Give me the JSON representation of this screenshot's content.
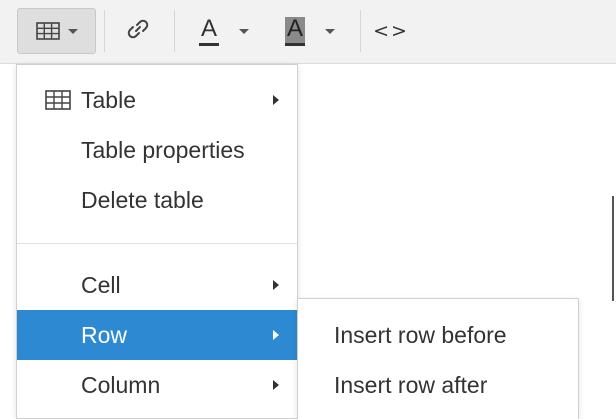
{
  "toolbar": {
    "buttons": [
      {
        "name": "table-dropdown-button",
        "icon": "table-icon",
        "has_caret": true,
        "active": true
      },
      {
        "name": "link-button",
        "icon": "link-icon"
      },
      {
        "name": "text-color-button",
        "icon": "text-color-icon",
        "glyph": "A",
        "has_caret": true
      },
      {
        "name": "background-color-button",
        "icon": "background-color-icon",
        "glyph": "A",
        "has_caret": true
      },
      {
        "name": "source-code-button",
        "icon": "code-icon",
        "glyph": "<>"
      }
    ]
  },
  "menu": {
    "items": [
      {
        "label": "Table",
        "icon": "table-icon",
        "has_submenu": true
      },
      {
        "label": "Table properties"
      },
      {
        "label": "Delete table"
      },
      {
        "label": "Cell",
        "has_submenu": true
      },
      {
        "label": "Row",
        "has_submenu": true,
        "selected": true
      },
      {
        "label": "Column",
        "has_submenu": true
      }
    ]
  },
  "submenu": {
    "items": [
      {
        "label": "Insert row before"
      },
      {
        "label": "Insert row after"
      }
    ]
  },
  "colors": {
    "selected_bg": "#2d8ad2",
    "selected_text": "#ffffff",
    "toolbar_bg": "#f2f2f2",
    "text": "#333333"
  }
}
